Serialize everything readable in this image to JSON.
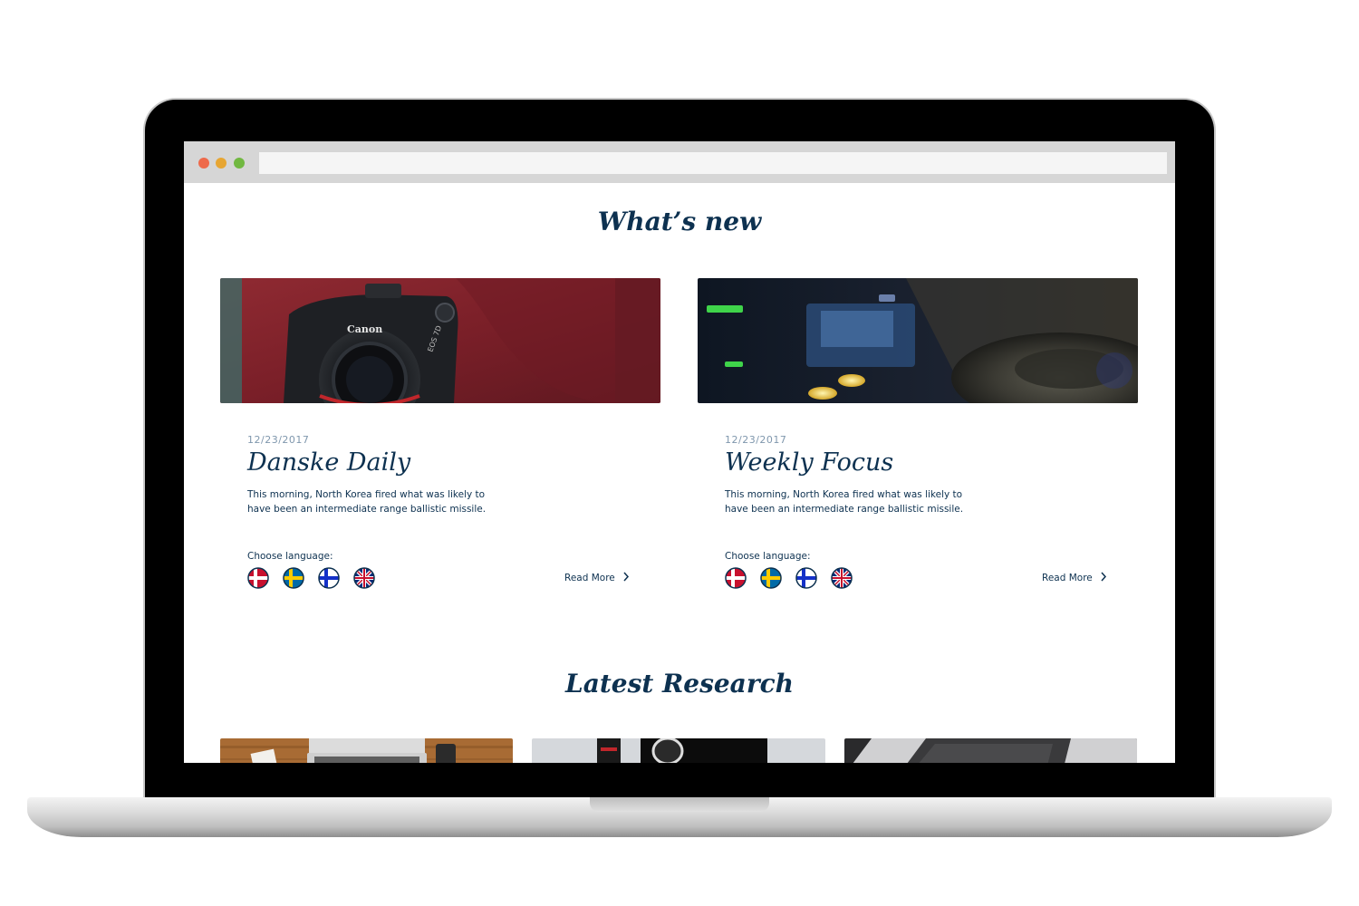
{
  "browser": {
    "address_value": ""
  },
  "whats_new": {
    "title": "What’s new",
    "cards": [
      {
        "date": "12/23/2017",
        "title": "Danske Daily",
        "description": "This morning, North Korea fired what was likely to have been an intermediate range ballistic missile.",
        "language_label": "Choose language:",
        "languages": [
          "Danish",
          "Swedish",
          "Finnish",
          "English"
        ],
        "read_more": "Read More",
        "image": "camera-photo"
      },
      {
        "date": "12/23/2017",
        "title": "Weekly Focus",
        "description": "This morning, North Korea fired what was likely to have been an intermediate range ballistic missile.",
        "language_label": "Choose language:",
        "languages": [
          "Danish",
          "Swedish",
          "Finnish",
          "English"
        ],
        "read_more": "Read More",
        "image": "dj-turntable-photo"
      }
    ]
  },
  "latest_research": {
    "title": "Latest Research",
    "tiles": [
      "laptop-desk-photo",
      "camera-lens-photo",
      "keyboard-photo"
    ]
  },
  "image_text": {
    "camera_brand": "Canon",
    "camera_model": "EOS 7D"
  },
  "colors": {
    "heading": "#0d3150",
    "date": "#7f97ad",
    "browser_bar": "#d6d6d6"
  }
}
